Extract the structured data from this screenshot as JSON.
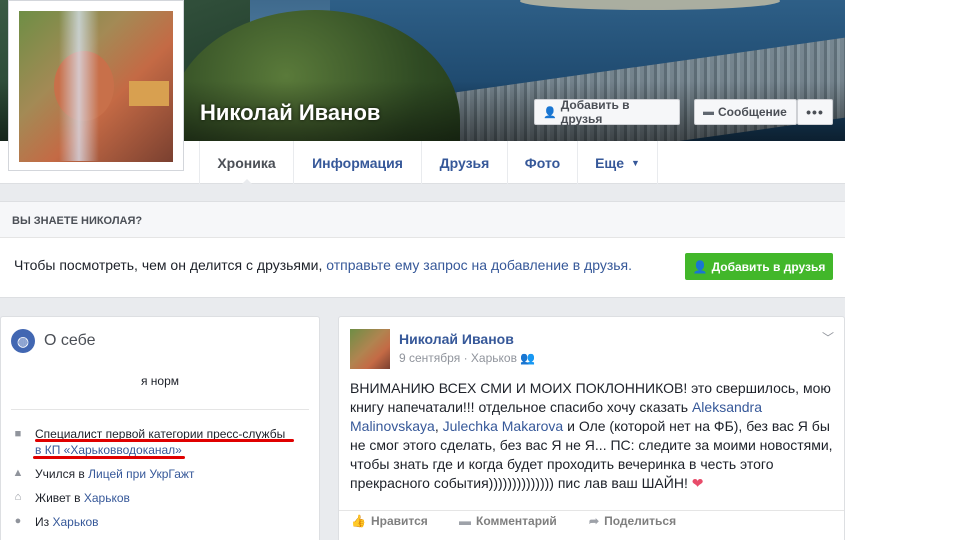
{
  "profile": {
    "name": "Николай Иванов"
  },
  "cover_buttons": {
    "add_friend": "Добавить в друзья",
    "message": "Сообщение",
    "more": "•••"
  },
  "tabs": [
    {
      "label": "Хроника",
      "active": true
    },
    {
      "label": "Информация"
    },
    {
      "label": "Друзья"
    },
    {
      "label": "Фото"
    },
    {
      "label": "Еще"
    }
  ],
  "know_box": {
    "heading": "ВЫ ЗНАЕТЕ НИКОЛАЯ?",
    "text": "Чтобы посмотреть, чем он делится с друзьями,",
    "link": "отправьте ему запрос на добавление в друзья.",
    "button": "Добавить в друзья"
  },
  "about": {
    "title": "О себе",
    "bio": "я норм",
    "job_line1": "Специалист первой категории пресс-службы",
    "job_line2": "в КП «Харьковводоканал»",
    "study_prefix": "Учился в",
    "study_link": "Лицей при УкрГажт",
    "lives_prefix": "Живет в",
    "lives_link": "Харьков",
    "from_prefix": "Из",
    "from_link": "Харьков"
  },
  "post": {
    "author": "Николай Иванов",
    "date": "9 сентября",
    "location": "Харьков",
    "text_1": "ВНИМАНИЮ ВСЕХ СМИ И МОИХ ПОКЛОННИКОВ! это свершилось, мою книгу напечатали!!! отдельное спасибо хочу сказать",
    "mention_1": "Aleksandra Malinovskaya",
    "sep_1": ",",
    "mention_2": "Julechka Makarova",
    "text_2": "и Оле (которой нет на ФБ), без вас Я бы не смог этого сделать, без вас Я не Я... ПС: следите за моими новостями, чтобы знать где и когда будет проходить вечеринка в честь этого прекрасного события)))))))))))))) пис лав ваш ШАЙН!",
    "heart": "❤",
    "like": "Нравится",
    "comment": "Комментарий",
    "share": "Поделиться"
  },
  "colors": {
    "link_blue": "#365899",
    "green_button": "#42b72a",
    "underline_red": "#e00000",
    "page_bg": "#e9ebee"
  }
}
